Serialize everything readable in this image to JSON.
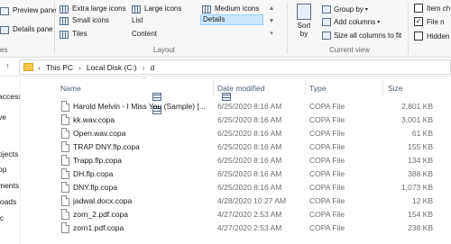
{
  "ribbon": {
    "panes": {
      "preview_pane": "Preview pane",
      "details_pane": "Details pane",
      "group_label": "es"
    },
    "layout": {
      "items": [
        {
          "label": "Extra large icons",
          "icon": "extra-large-icons-icon"
        },
        {
          "label": "Large icons",
          "icon": "large-icons-icon"
        },
        {
          "label": "Medium icons",
          "icon": "medium-icons-icon"
        },
        {
          "label": "Small icons",
          "icon": "small-icons-icon"
        },
        {
          "label": "List",
          "icon": "list-icon"
        },
        {
          "label": "Details",
          "icon": "details-icon",
          "selected": true
        },
        {
          "label": "Tiles",
          "icon": "tiles-icon"
        },
        {
          "label": "Content",
          "icon": "content-icon"
        }
      ],
      "group_label": "Layout"
    },
    "current_view": {
      "sort_by": "Sort by",
      "group_by": "Group by",
      "add_columns": "Add columns",
      "size_all_columns": "Size all columns to fit",
      "group_label": "Current view"
    },
    "show_hide": {
      "item_check_boxes": "Item ch",
      "file_name_extensions": "File n",
      "hidden_items": "Hidden",
      "item_check_boxes_checked": false,
      "file_name_extensions_checked": true,
      "hidden_items_checked": false
    }
  },
  "address_bar": {
    "crumbs": [
      "This PC",
      "Local Disk (C:)",
      "d"
    ]
  },
  "nav_pane": {
    "items": [
      "access",
      "ve",
      "",
      "ojects",
      "op",
      "ments",
      "loads",
      "ic"
    ]
  },
  "file_list": {
    "columns": {
      "name": "Name",
      "date_modified": "Date modified",
      "type": "Type",
      "size": "Size"
    },
    "rows": [
      {
        "name": "Harold Melvin - I Miss You (Sample) [...",
        "date": "6/25/2020 8:16 AM",
        "type": "COPA File",
        "size": "2,801 KB"
      },
      {
        "name": "kk.wav.copa",
        "date": "6/25/2020 8:16 AM",
        "type": "COPA File",
        "size": "3,001 KB"
      },
      {
        "name": "Open.wav.copa",
        "date": "6/25/2020 8:16 AM",
        "type": "COPA File",
        "size": "61 KB"
      },
      {
        "name": "TRAP DNY.flp.copa",
        "date": "6/25/2020 8:16 AM",
        "type": "COPA File",
        "size": "155 KB"
      },
      {
        "name": "Trapp.flp.copa",
        "date": "6/25/2020 8:16 AM",
        "type": "COPA File",
        "size": "134 KB"
      },
      {
        "name": "DH.flp.copa",
        "date": "6/25/2020 8:16 AM",
        "type": "COPA File",
        "size": "388 KB"
      },
      {
        "name": "DNY.flp.copa",
        "date": "6/25/2020 8:16 AM",
        "type": "COPA File",
        "size": "1,073 KB"
      },
      {
        "name": "jadwal.docx.copa",
        "date": "4/28/2020 10:27 AM",
        "type": "COPA File",
        "size": "12 KB"
      },
      {
        "name": "zorn_2.pdf.copa",
        "date": "4/27/2020 2:53 AM",
        "type": "COPA File",
        "size": "154 KB"
      },
      {
        "name": "zorn1.pdf.copa",
        "date": "4/27/2020 2:53 AM",
        "type": "COPA File",
        "size": "238 KB"
      }
    ]
  },
  "colors": {
    "accent_selected": "#cce8ff",
    "folder": "#f5c94a",
    "header_text": "#4c607a"
  }
}
